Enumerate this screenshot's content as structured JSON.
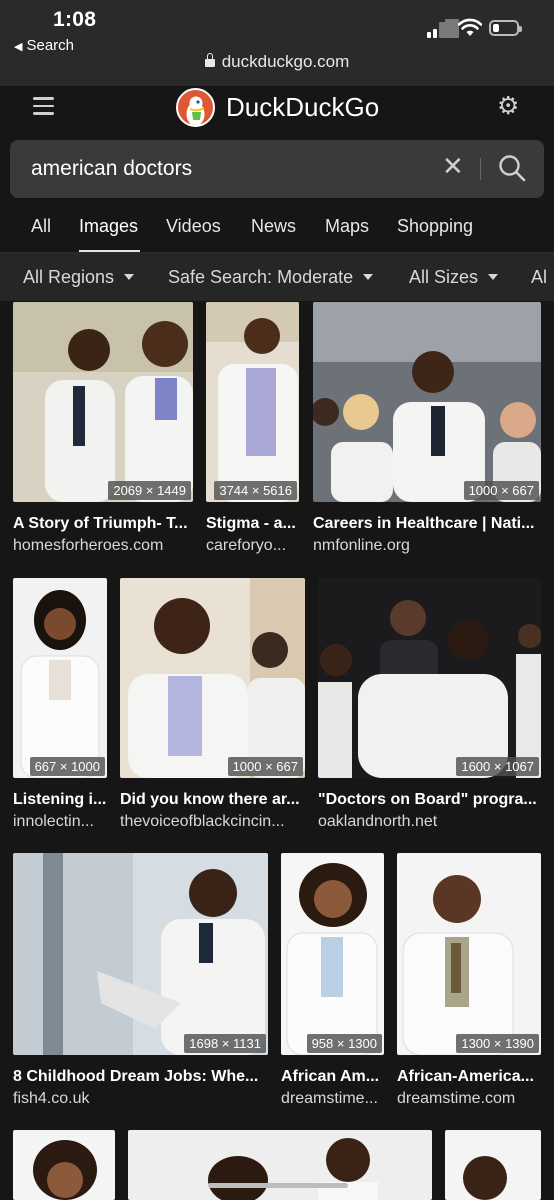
{
  "status": {
    "time": "1:08",
    "back_label": "Search"
  },
  "browser": {
    "url": "duckduckgo.com"
  },
  "header": {
    "brand": "DuckDuckGo"
  },
  "search": {
    "query": "american doctors"
  },
  "tabs": [
    "All",
    "Images",
    "Videos",
    "News",
    "Maps",
    "Shopping"
  ],
  "active_tab": "Images",
  "filters": [
    "All Regions",
    "Safe Search: Moderate",
    "All Sizes",
    "Al"
  ],
  "results": [
    {
      "title": "A Story of Triumph- T...",
      "source": "homesforheroes.com",
      "dims": "2069 × 1449"
    },
    {
      "title": "Stigma - a...",
      "source": "careforyo...",
      "dims": "3744 × 5616"
    },
    {
      "title": "Careers in Healthcare | Nati...",
      "source": "nmfonline.org",
      "dims": "1000 × 667"
    },
    {
      "title": "Listening i...",
      "source": "innolectin...",
      "dims": "667 × 1000"
    },
    {
      "title": "Did you know there ar...",
      "source": "thevoiceofblackcincin...",
      "dims": "1000 × 667"
    },
    {
      "title": "\"Doctors on Board\" progra...",
      "source": "oaklandnorth.net",
      "dims": "1600 × 1067"
    },
    {
      "title": "8 Childhood Dream Jobs: Whe...",
      "source": "fish4.co.uk",
      "dims": "1698 × 1131"
    },
    {
      "title": "African Am...",
      "source": "dreamstime...",
      "dims": "958 × 1300"
    },
    {
      "title": "African-America...",
      "source": "dreamstime.com",
      "dims": "1300 × 1390"
    }
  ],
  "colors": {
    "page_bg": "#161616",
    "bar_bg": "#2a2a2a",
    "search_bg": "#3a3a3a",
    "filter_bg": "#262626",
    "brand_orange": "#de5833"
  }
}
